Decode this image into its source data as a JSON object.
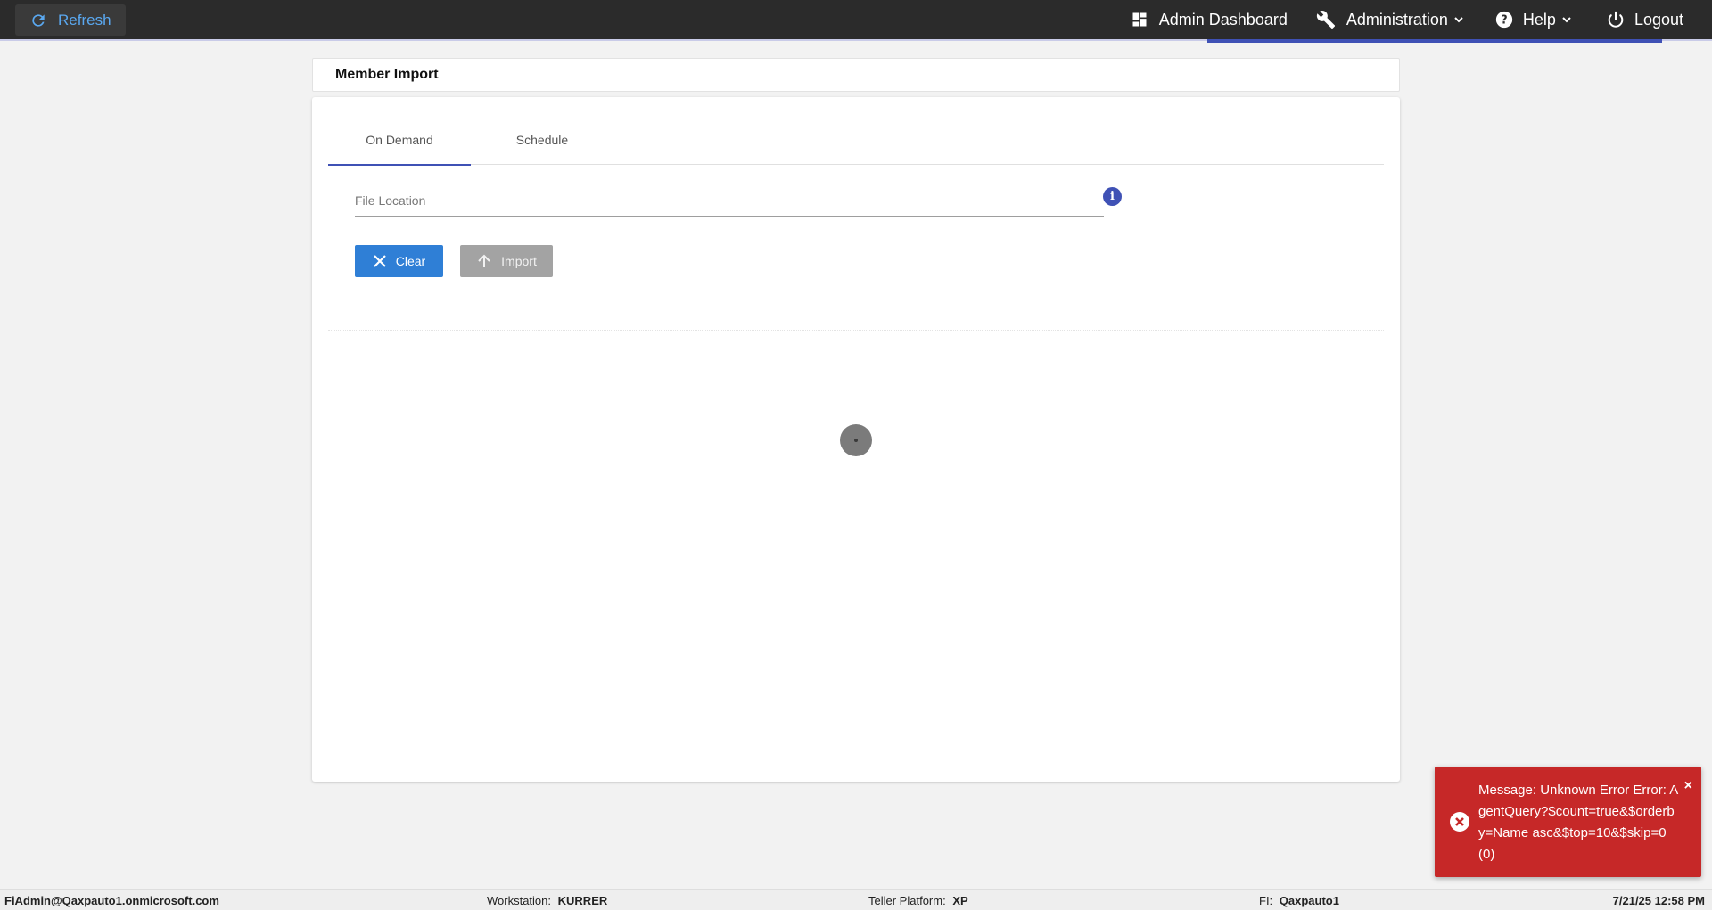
{
  "topbar": {
    "refresh_label": "Refresh",
    "nav": {
      "dashboard_label": "Admin Dashboard",
      "administration_label": "Administration",
      "help_label": "Help",
      "logout_label": "Logout"
    }
  },
  "page": {
    "title": "Member Import"
  },
  "tabs": [
    {
      "label": "On Demand",
      "active": true
    },
    {
      "label": "Schedule",
      "active": false
    }
  ],
  "form": {
    "file_location_placeholder": "File Location",
    "file_location_value": "",
    "clear_label": "Clear",
    "import_label": "Import"
  },
  "toast": {
    "message": "Message: Unknown Error Error: AgentQuery?$count=true&$orderby=Name asc&$top=10&$skip=0 (0)",
    "close_symbol": "×"
  },
  "footer": {
    "user": "FiAdmin@Qaxpauto1.onmicrosoft.com",
    "workstation_label": "Workstation:",
    "workstation_value": "KURRER",
    "teller_label": "Teller Platform:",
    "teller_value": "XP",
    "fi_label": "FI:",
    "fi_value": "Qaxpauto1",
    "datetime": "7/21/25 12:58 PM"
  },
  "colors": {
    "topbar_bg": "#2b2b2b",
    "accent": "#3f51b5",
    "clear_btn": "#2f7fd6",
    "import_btn_disabled": "#a3a3a3",
    "toast_error": "#c62828",
    "refresh_text": "#5aa8f0"
  },
  "icons": {
    "refresh": "refresh-icon",
    "dashboard": "dashboard-grid-icon",
    "administration": "wrench-icon",
    "help": "help-circle-icon",
    "logout": "power-icon",
    "clear": "close-icon",
    "import": "arrow-up-icon",
    "info": "info-icon",
    "toast_error": "error-circle-icon"
  }
}
